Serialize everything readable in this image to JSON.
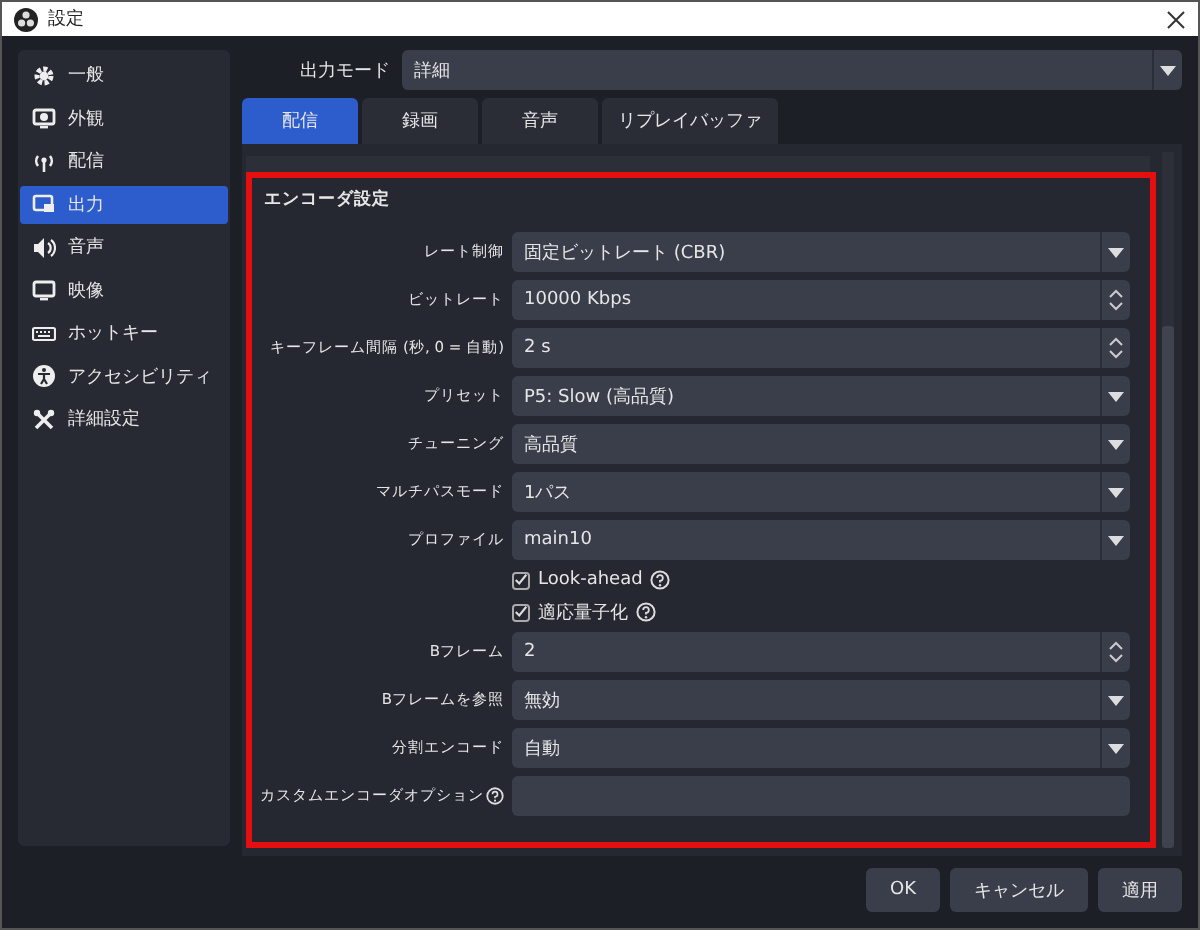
{
  "window": {
    "title": "設定"
  },
  "sidebar": {
    "items": [
      {
        "label": "一般",
        "selected": false
      },
      {
        "label": "外観",
        "selected": false
      },
      {
        "label": "配信",
        "selected": false
      },
      {
        "label": "出力",
        "selected": true
      },
      {
        "label": "音声",
        "selected": false
      },
      {
        "label": "映像",
        "selected": false
      },
      {
        "label": "ホットキー",
        "selected": false
      },
      {
        "label": "アクセシビリティ",
        "selected": false
      },
      {
        "label": "詳細設定",
        "selected": false
      }
    ]
  },
  "output_mode": {
    "label": "出力モード",
    "value": "詳細"
  },
  "tabs": [
    {
      "label": "配信",
      "selected": true
    },
    {
      "label": "録画",
      "selected": false
    },
    {
      "label": "音声",
      "selected": false
    },
    {
      "label": "リプレイバッファ",
      "selected": false
    }
  ],
  "encoder_settings": {
    "title": "エンコーダ設定",
    "rows": [
      {
        "kind": "select",
        "label": "レート制御",
        "value": "固定ビットレート (CBR)"
      },
      {
        "kind": "spin",
        "label": "ビットレート",
        "value": "10000 Kbps"
      },
      {
        "kind": "spin",
        "label": "キーフレーム間隔 (秒, 0 = 自動)",
        "value": "2 s"
      },
      {
        "kind": "select",
        "label": "プリセット",
        "value": "P5: Slow (高品質)"
      },
      {
        "kind": "select",
        "label": "チューニング",
        "value": "高品質"
      },
      {
        "kind": "select",
        "label": "マルチパスモード",
        "value": "1パス"
      },
      {
        "kind": "select",
        "label": "プロファイル",
        "value": "main10"
      },
      {
        "kind": "checkbox",
        "label": "Look-ahead",
        "checked": true,
        "help": true
      },
      {
        "kind": "checkbox",
        "label": "適応量子化",
        "checked": true,
        "help": true
      },
      {
        "kind": "spin",
        "label": "Bフレーム",
        "value": "2"
      },
      {
        "kind": "select",
        "label": "Bフレームを参照",
        "value": "無効"
      },
      {
        "kind": "select",
        "label": "分割エンコード",
        "value": "自動"
      },
      {
        "kind": "text",
        "label": "カスタムエンコーダオプション",
        "help": true
      }
    ]
  },
  "buttons": [
    "OK",
    "キャンセル",
    "適用"
  ]
}
